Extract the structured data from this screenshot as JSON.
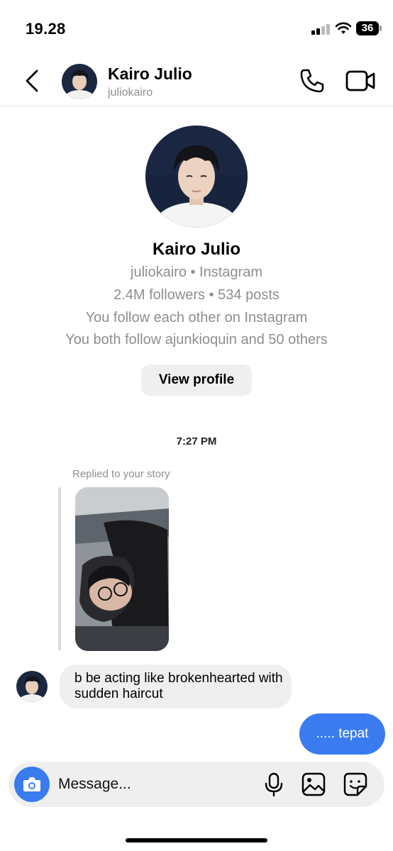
{
  "status_bar": {
    "time": "19.28",
    "battery": "36"
  },
  "header": {
    "name": "Kairo Julio",
    "handle": "juliokairo"
  },
  "profile": {
    "name": "Kairo Julio",
    "handle_line": "juliokairo • Instagram",
    "stats_line": "2.4M followers • 534 posts",
    "follow_line": "You follow each other on Instagram",
    "mutual_line": "You both follow ajunkioquin and 50 others",
    "view_profile_label": "View profile"
  },
  "thread": {
    "timestamp": "7:27 PM",
    "replied_label": "Replied to your story",
    "incoming_message": "b be acting like brokenhearted with sudden haircut",
    "outgoing_message": "..... tepat"
  },
  "composer": {
    "placeholder": "Message..."
  },
  "colors": {
    "accent": "#3a7cf0",
    "bubble_gray": "#efefef",
    "secondary_text": "#8e8e8e"
  }
}
